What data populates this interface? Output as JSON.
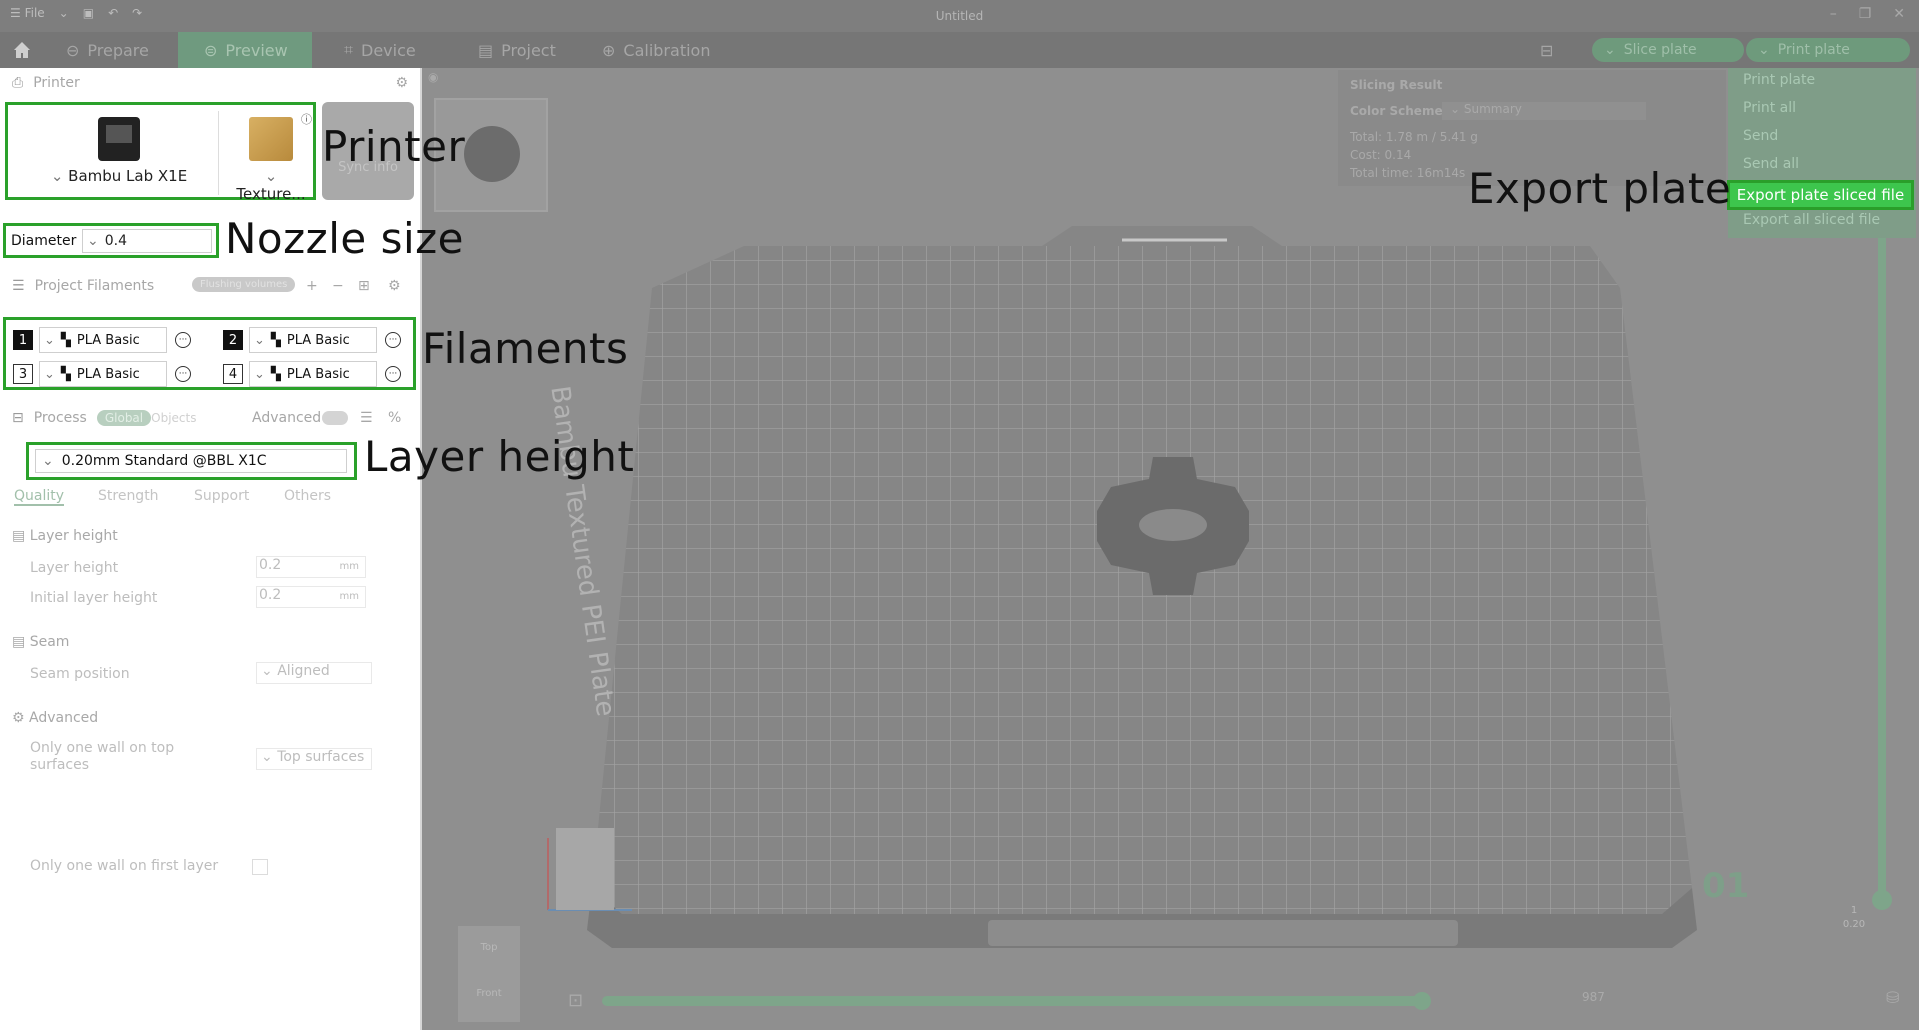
{
  "titlebar": {
    "file_label": "File",
    "title": "Untitled"
  },
  "tabs": [
    {
      "label": "Prepare"
    },
    {
      "label": "Preview"
    },
    {
      "label": "Device"
    },
    {
      "label": "Project"
    },
    {
      "label": "Calibration"
    }
  ],
  "toolbar": {
    "slice_label": "Slice plate",
    "print_label": "Print plate"
  },
  "printer_section": {
    "title": "Printer",
    "printer_name": "Bambu Lab X1E",
    "plate_name": "Texture...",
    "sync_label": "Sync info"
  },
  "nozzle": {
    "label": "Diameter",
    "value": "0.4"
  },
  "filaments_section": {
    "title": "Project Filaments",
    "flush_label": "Flushing volumes",
    "items": [
      {
        "num": "1",
        "name": "PLA Basic"
      },
      {
        "num": "2",
        "name": "PLA Basic"
      },
      {
        "num": "3",
        "name": "PLA Basic"
      },
      {
        "num": "4",
        "name": "PLA Basic"
      }
    ]
  },
  "process_section": {
    "title": "Process",
    "global_label": "Global",
    "objects_label": "Objects",
    "advanced_label": "Advanced",
    "preset": "0.20mm Standard @BBL X1C",
    "tabs": [
      "Quality",
      "Strength",
      "Support",
      "Others"
    ]
  },
  "settings": {
    "layer_height_group": "Layer height",
    "layer_height_label": "Layer height",
    "layer_height_value": "0.2",
    "initial_layer_label": "Initial layer height",
    "initial_layer_value": "0.2",
    "unit": "mm",
    "seam_group": "Seam",
    "seam_position_label": "Seam position",
    "seam_position_value": "Aligned",
    "advanced_group": "Advanced",
    "one_wall_top_label": "Only one wall on top surfaces",
    "one_wall_top_value": "Top surfaces",
    "one_wall_first_label": "Only one wall on first layer"
  },
  "slicing_result": {
    "title": "Slicing Result",
    "color_scheme_label": "Color Scheme",
    "color_scheme_value": "Summary",
    "total": "Total: 1.78 m / 5.41 g",
    "cost": "Cost: 0.14",
    "total_time": "Total time: 16m14s"
  },
  "print_menu": {
    "items": [
      "Print plate",
      "Print all",
      "Send",
      "Send all",
      "Export plate sliced file",
      "Export all sliced file"
    ]
  },
  "viewport": {
    "plate_text": "Bambu Textured PEI Plate",
    "plate_number": "01",
    "layer_top": "1",
    "layer_value": "0.20",
    "slider_value": "987",
    "nav_top": "Top",
    "nav_front": "Front"
  },
  "annotations": {
    "printer": "Printer",
    "nozzle": "Nozzle size",
    "filaments": "Filaments",
    "layer_height": "Layer height",
    "export": "Export plate"
  },
  "colors": {
    "highlight": "#2aa12a",
    "accent": "#3dc64d"
  }
}
